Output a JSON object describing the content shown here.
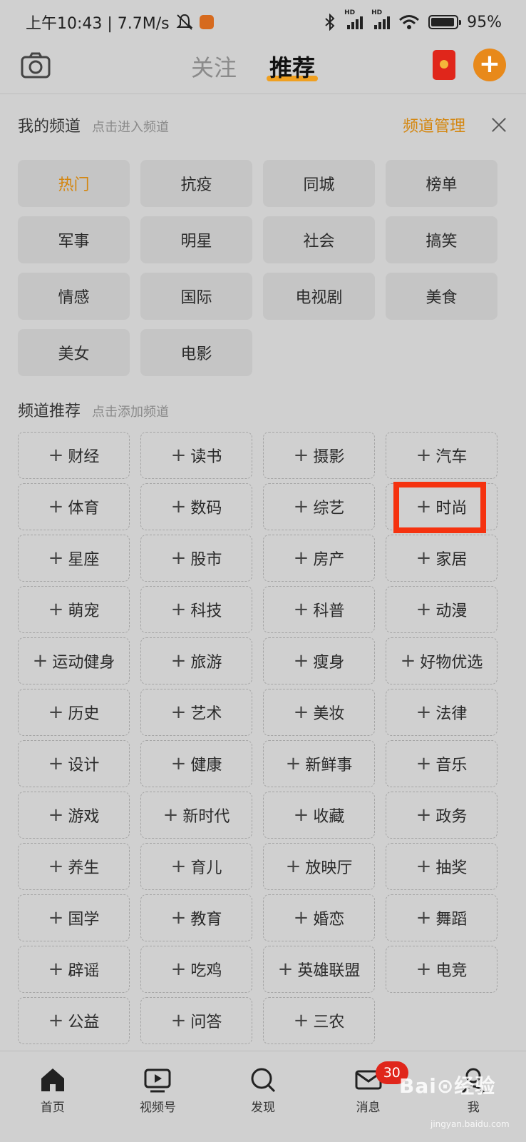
{
  "status_bar": {
    "time": "上午10:43 | 7.7M/s",
    "battery": "95%",
    "battery_level": 0.95
  },
  "header": {
    "tabs": [
      {
        "label": "关注",
        "active": false
      },
      {
        "label": "推荐",
        "active": true
      }
    ],
    "icons": [
      "camera-icon",
      "red-packet-icon",
      "plus-icon"
    ],
    "accent_color": "#e8891a"
  },
  "my_channels": {
    "title": "我的频道",
    "hint": "点击进入频道",
    "manage_label": "频道管理",
    "items": [
      "热门",
      "抗疫",
      "同城",
      "榜单",
      "军事",
      "明星",
      "社会",
      "搞笑",
      "情感",
      "国际",
      "电视剧",
      "美食",
      "美女",
      "电影"
    ]
  },
  "recommended_channels": {
    "title": "频道推荐",
    "hint": "点击添加频道",
    "items": [
      "财经",
      "读书",
      "摄影",
      "汽车",
      "体育",
      "数码",
      "综艺",
      "时尚",
      "星座",
      "股市",
      "房产",
      "家居",
      "萌宠",
      "科技",
      "科普",
      "动漫",
      "运动健身",
      "旅游",
      "瘦身",
      "好物优选",
      "历史",
      "艺术",
      "美妆",
      "法律",
      "设计",
      "健康",
      "新鲜事",
      "音乐",
      "游戏",
      "新时代",
      "收藏",
      "政务",
      "养生",
      "育儿",
      "放映厅",
      "抽奖",
      "国学",
      "教育",
      "婚恋",
      "舞蹈",
      "辟谣",
      "吃鸡",
      "英雄联盟",
      "电竞",
      "公益",
      "问答",
      "三农"
    ],
    "highlighted_item": "时尚"
  },
  "bottom_nav": {
    "items": [
      {
        "label": "首页",
        "icon": "home-icon"
      },
      {
        "label": "视频号",
        "icon": "video-icon"
      },
      {
        "label": "发现",
        "icon": "search-icon"
      },
      {
        "label": "消息",
        "icon": "mail-icon",
        "badge": "30"
      },
      {
        "label": "我",
        "icon": "profile-icon"
      }
    ]
  },
  "watermark": {
    "text": "Bai⊙经验",
    "sub": "jingyan.baidu.com"
  }
}
